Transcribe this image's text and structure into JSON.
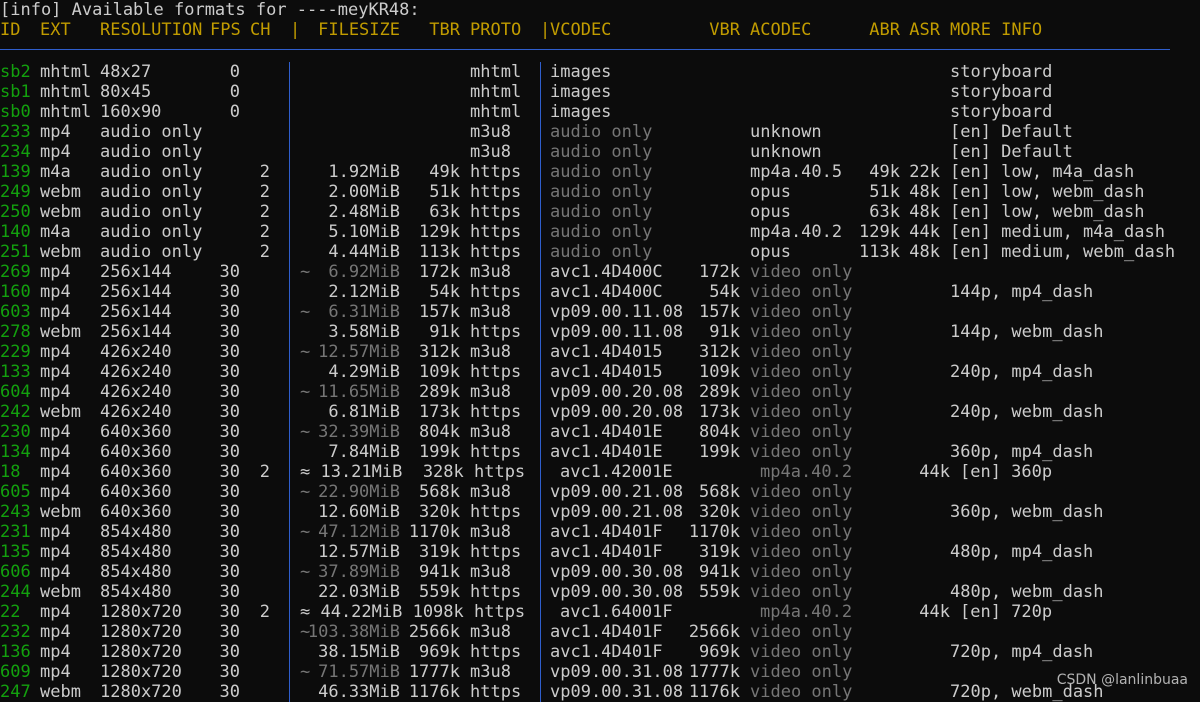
{
  "info_line": "[info] Available formats for ----meyKR48:",
  "header": {
    "id": "ID",
    "ext": "EXT",
    "res": "RESOLUTION",
    "fps": "FPS",
    "ch": "CH",
    "sep1": "|",
    "size": "FILESIZE",
    "tbr": "TBR",
    "proto": "PROTO",
    "sep2": "|",
    "vcodec": "VCODEC",
    "vbr": "VBR",
    "acodec": "ACODEC",
    "abr": "ABR",
    "asr": "ASR",
    "more": "MORE INFO"
  },
  "rows": [
    {
      "id": "sb2",
      "ext": "mhtml",
      "res": "48x27",
      "fps": "0",
      "ch": "",
      "tilde": "",
      "size": "",
      "tbr": "",
      "proto": "mhtml",
      "vcodec": "images",
      "vbr": "",
      "acodec": "",
      "abr": "",
      "asr": "",
      "more": "storyboard"
    },
    {
      "id": "sb1",
      "ext": "mhtml",
      "res": "80x45",
      "fps": "0",
      "ch": "",
      "tilde": "",
      "size": "",
      "tbr": "",
      "proto": "mhtml",
      "vcodec": "images",
      "vbr": "",
      "acodec": "",
      "abr": "",
      "asr": "",
      "more": "storyboard"
    },
    {
      "id": "sb0",
      "ext": "mhtml",
      "res": "160x90",
      "fps": "0",
      "ch": "",
      "tilde": "",
      "size": "",
      "tbr": "",
      "proto": "mhtml",
      "vcodec": "images",
      "vbr": "",
      "acodec": "",
      "abr": "",
      "asr": "",
      "more": "storyboard"
    },
    {
      "id": "233",
      "ext": "mp4",
      "res": "audio only",
      "fps": "",
      "ch": "",
      "tilde": "",
      "size": "",
      "tbr": "",
      "proto": "m3u8",
      "vcodec": "audio only",
      "vbr": "",
      "acodec": "unknown",
      "abr": "",
      "asr": "",
      "more": "[en] Default"
    },
    {
      "id": "234",
      "ext": "mp4",
      "res": "audio only",
      "fps": "",
      "ch": "",
      "tilde": "",
      "size": "",
      "tbr": "",
      "proto": "m3u8",
      "vcodec": "audio only",
      "vbr": "",
      "acodec": "unknown",
      "abr": "",
      "asr": "",
      "more": "[en] Default"
    },
    {
      "id": "139",
      "ext": "m4a",
      "res": "audio only",
      "fps": "",
      "ch": "2",
      "tilde": "",
      "size": "1.92MiB",
      "tbr": "49k",
      "proto": "https",
      "vcodec": "audio only",
      "vbr": "",
      "acodec": "mp4a.40.5",
      "abr": "49k",
      "asr": "22k",
      "more": "[en] low, m4a_dash"
    },
    {
      "id": "249",
      "ext": "webm",
      "res": "audio only",
      "fps": "",
      "ch": "2",
      "tilde": "",
      "size": "2.00MiB",
      "tbr": "51k",
      "proto": "https",
      "vcodec": "audio only",
      "vbr": "",
      "acodec": "opus",
      "abr": "51k",
      "asr": "48k",
      "more": "[en] low, webm_dash"
    },
    {
      "id": "250",
      "ext": "webm",
      "res": "audio only",
      "fps": "",
      "ch": "2",
      "tilde": "",
      "size": "2.48MiB",
      "tbr": "63k",
      "proto": "https",
      "vcodec": "audio only",
      "vbr": "",
      "acodec": "opus",
      "abr": "63k",
      "asr": "48k",
      "more": "[en] low, webm_dash"
    },
    {
      "id": "140",
      "ext": "m4a",
      "res": "audio only",
      "fps": "",
      "ch": "2",
      "tilde": "",
      "size": "5.10MiB",
      "tbr": "129k",
      "proto": "https",
      "vcodec": "audio only",
      "vbr": "",
      "acodec": "mp4a.40.2",
      "abr": "129k",
      "asr": "44k",
      "more": "[en] medium, m4a_dash"
    },
    {
      "id": "251",
      "ext": "webm",
      "res": "audio only",
      "fps": "",
      "ch": "2",
      "tilde": "",
      "size": "4.44MiB",
      "tbr": "113k",
      "proto": "https",
      "vcodec": "audio only",
      "vbr": "",
      "acodec": "opus",
      "abr": "113k",
      "asr": "48k",
      "more": "[en] medium, webm_dash"
    },
    {
      "id": "269",
      "ext": "mp4",
      "res": "256x144",
      "fps": "30",
      "ch": "",
      "tilde": "~",
      "size": "6.92MiB",
      "tbr": "172k",
      "proto": "m3u8",
      "vcodec": "avc1.4D400C",
      "vbr": "172k",
      "acodec": "video only",
      "abr": "",
      "asr": "",
      "more": ""
    },
    {
      "id": "160",
      "ext": "mp4",
      "res": "256x144",
      "fps": "30",
      "ch": "",
      "tilde": "",
      "size": "2.12MiB",
      "tbr": "54k",
      "proto": "https",
      "vcodec": "avc1.4D400C",
      "vbr": "54k",
      "acodec": "video only",
      "abr": "",
      "asr": "",
      "more": "144p, mp4_dash"
    },
    {
      "id": "603",
      "ext": "mp4",
      "res": "256x144",
      "fps": "30",
      "ch": "",
      "tilde": "~",
      "size": "6.31MiB",
      "tbr": "157k",
      "proto": "m3u8",
      "vcodec": "vp09.00.11.08",
      "vbr": "157k",
      "acodec": "video only",
      "abr": "",
      "asr": "",
      "more": ""
    },
    {
      "id": "278",
      "ext": "webm",
      "res": "256x144",
      "fps": "30",
      "ch": "",
      "tilde": "",
      "size": "3.58MiB",
      "tbr": "91k",
      "proto": "https",
      "vcodec": "vp09.00.11.08",
      "vbr": "91k",
      "acodec": "video only",
      "abr": "",
      "asr": "",
      "more": "144p, webm_dash"
    },
    {
      "id": "229",
      "ext": "mp4",
      "res": "426x240",
      "fps": "30",
      "ch": "",
      "tilde": "~",
      "size": "12.57MiB",
      "tbr": "312k",
      "proto": "m3u8",
      "vcodec": "avc1.4D4015",
      "vbr": "312k",
      "acodec": "video only",
      "abr": "",
      "asr": "",
      "more": ""
    },
    {
      "id": "133",
      "ext": "mp4",
      "res": "426x240",
      "fps": "30",
      "ch": "",
      "tilde": "",
      "size": "4.29MiB",
      "tbr": "109k",
      "proto": "https",
      "vcodec": "avc1.4D4015",
      "vbr": "109k",
      "acodec": "video only",
      "abr": "",
      "asr": "",
      "more": "240p, mp4_dash"
    },
    {
      "id": "604",
      "ext": "mp4",
      "res": "426x240",
      "fps": "30",
      "ch": "",
      "tilde": "~",
      "size": "11.65MiB",
      "tbr": "289k",
      "proto": "m3u8",
      "vcodec": "vp09.00.20.08",
      "vbr": "289k",
      "acodec": "video only",
      "abr": "",
      "asr": "",
      "more": ""
    },
    {
      "id": "242",
      "ext": "webm",
      "res": "426x240",
      "fps": "30",
      "ch": "",
      "tilde": "",
      "size": "6.81MiB",
      "tbr": "173k",
      "proto": "https",
      "vcodec": "vp09.00.20.08",
      "vbr": "173k",
      "acodec": "video only",
      "abr": "",
      "asr": "",
      "more": "240p, webm_dash"
    },
    {
      "id": "230",
      "ext": "mp4",
      "res": "640x360",
      "fps": "30",
      "ch": "",
      "tilde": "~",
      "size": "32.39MiB",
      "tbr": "804k",
      "proto": "m3u8",
      "vcodec": "avc1.4D401E",
      "vbr": "804k",
      "acodec": "video only",
      "abr": "",
      "asr": "",
      "more": ""
    },
    {
      "id": "134",
      "ext": "mp4",
      "res": "640x360",
      "fps": "30",
      "ch": "",
      "tilde": "",
      "size": "7.84MiB",
      "tbr": "199k",
      "proto": "https",
      "vcodec": "avc1.4D401E",
      "vbr": "199k",
      "acodec": "video only",
      "abr": "",
      "asr": "",
      "more": "360p, mp4_dash"
    },
    {
      "id": "18",
      "ext": "mp4",
      "res": "640x360",
      "fps": "30",
      "ch": "2",
      "tilde": "",
      "combined": "≈ 13.21MiB  328k https",
      "vcodec": "avc1.42001E",
      "acodec": "mp4a.40.2",
      "asr": "44k",
      "more": "[en] 360p",
      "special": true
    },
    {
      "id": "605",
      "ext": "mp4",
      "res": "640x360",
      "fps": "30",
      "ch": "",
      "tilde": "~",
      "size": "22.90MiB",
      "tbr": "568k",
      "proto": "m3u8",
      "vcodec": "vp09.00.21.08",
      "vbr": "568k",
      "acodec": "video only",
      "abr": "",
      "asr": "",
      "more": ""
    },
    {
      "id": "243",
      "ext": "webm",
      "res": "640x360",
      "fps": "30",
      "ch": "",
      "tilde": "",
      "size": "12.60MiB",
      "tbr": "320k",
      "proto": "https",
      "vcodec": "vp09.00.21.08",
      "vbr": "320k",
      "acodec": "video only",
      "abr": "",
      "asr": "",
      "more": "360p, webm_dash"
    },
    {
      "id": "231",
      "ext": "mp4",
      "res": "854x480",
      "fps": "30",
      "ch": "",
      "tilde": "~",
      "size": "47.12MiB",
      "tbr": "1170k",
      "proto": "m3u8",
      "vcodec": "avc1.4D401F",
      "vbr": "1170k",
      "acodec": "video only",
      "abr": "",
      "asr": "",
      "more": ""
    },
    {
      "id": "135",
      "ext": "mp4",
      "res": "854x480",
      "fps": "30",
      "ch": "",
      "tilde": "",
      "size": "12.57MiB",
      "tbr": "319k",
      "proto": "https",
      "vcodec": "avc1.4D401F",
      "vbr": "319k",
      "acodec": "video only",
      "abr": "",
      "asr": "",
      "more": "480p, mp4_dash"
    },
    {
      "id": "606",
      "ext": "mp4",
      "res": "854x480",
      "fps": "30",
      "ch": "",
      "tilde": "~",
      "size": "37.89MiB",
      "tbr": "941k",
      "proto": "m3u8",
      "vcodec": "vp09.00.30.08",
      "vbr": "941k",
      "acodec": "video only",
      "abr": "",
      "asr": "",
      "more": ""
    },
    {
      "id": "244",
      "ext": "webm",
      "res": "854x480",
      "fps": "30",
      "ch": "",
      "tilde": "",
      "size": "22.03MiB",
      "tbr": "559k",
      "proto": "https",
      "vcodec": "vp09.00.30.08",
      "vbr": "559k",
      "acodec": "video only",
      "abr": "",
      "asr": "",
      "more": "480p, webm_dash"
    },
    {
      "id": "22",
      "ext": "mp4",
      "res": "1280x720",
      "fps": "30",
      "ch": "2",
      "tilde": "",
      "combined": "≈ 44.22MiB 1098k https",
      "vcodec": "avc1.64001F",
      "acodec": "mp4a.40.2",
      "asr": "44k",
      "more": "[en] 720p",
      "special": true
    },
    {
      "id": "232",
      "ext": "mp4",
      "res": "1280x720",
      "fps": "30",
      "ch": "",
      "tilde": "~",
      "size": "103.38MiB",
      "tbr": "2566k",
      "proto": "m3u8",
      "vcodec": "avc1.4D401F",
      "vbr": "2566k",
      "acodec": "video only",
      "abr": "",
      "asr": "",
      "more": ""
    },
    {
      "id": "136",
      "ext": "mp4",
      "res": "1280x720",
      "fps": "30",
      "ch": "",
      "tilde": "",
      "size": "38.15MiB",
      "tbr": "969k",
      "proto": "https",
      "vcodec": "avc1.4D401F",
      "vbr": "969k",
      "acodec": "video only",
      "abr": "",
      "asr": "",
      "more": "720p, mp4_dash"
    },
    {
      "id": "609",
      "ext": "mp4",
      "res": "1280x720",
      "fps": "30",
      "ch": "",
      "tilde": "~",
      "size": "71.57MiB",
      "tbr": "1777k",
      "proto": "m3u8",
      "vcodec": "vp09.00.31.08",
      "vbr": "1777k",
      "acodec": "video only",
      "abr": "",
      "asr": "",
      "more": ""
    },
    {
      "id": "247",
      "ext": "webm",
      "res": "1280x720",
      "fps": "30",
      "ch": "",
      "tilde": "",
      "size": "46.33MiB",
      "tbr": "1176k",
      "proto": "https",
      "vcodec": "vp09.00.31.08",
      "vbr": "1176k",
      "acodec": "video only",
      "abr": "",
      "asr": "",
      "more": "720p, webm_dash"
    }
  ],
  "watermark": "CSDN @lanlinbuaa"
}
